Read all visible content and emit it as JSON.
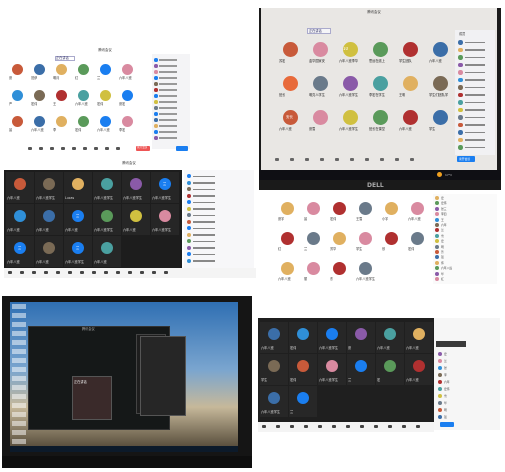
{
  "pane_tl": {
    "title": "腾讯会议",
    "topic": "正在讲话",
    "names": [
      "张",
      "范伊",
      "明月",
      "红",
      "兰",
      "六年八班",
      "严",
      "宏伟",
      "王",
      "六年八班",
      "宏伟",
      "张宏",
      "晨",
      "六年八班",
      "李",
      "宏伟",
      "六年八班",
      "李宏"
    ],
    "leave_button": "离开会议"
  },
  "pane_tr": {
    "title": "腾讯会议",
    "topic": "正在讲话",
    "names": [
      "苏宏",
      "金华国家安",
      "六年八班李华",
      "思远在线上",
      "学生团队",
      "六年八班",
      "班长",
      "明亮人学生",
      "六年八班学生",
      "李宏在学生",
      "王明",
      "学生们团队学",
      "六年八班",
      "张雪",
      "六年八班学生",
      "班长在课堂",
      "六年八班",
      "学生"
    ],
    "sidebar_title": "成员",
    "badge": "10",
    "avatar_badge": "安长",
    "leave_button": "离开会议",
    "weather": "17°C",
    "brand": "DELL"
  },
  "pane_ml": {
    "title": "腾讯会议",
    "names": [
      "六年八班",
      "六年八班学生",
      "Lucas",
      "六年八班学生",
      "六年八班学生",
      "六年八班学生",
      "六年八班",
      "六年八班",
      "六年八班",
      "六年八班学生",
      "六年八班",
      "六年八班学生",
      "六年八班",
      "六年八班",
      "六年八班学生",
      "六年八班"
    ],
    "avatar_badges": [
      "兰",
      "兰",
      "兰",
      "兰",
      "兰"
    ]
  },
  "pane_mr": {
    "names": [
      "张宇",
      "晨",
      "宏伟",
      "王雪",
      "小宇",
      "六年八班",
      "红",
      "兰",
      "芳华",
      "学生",
      "欣",
      "宏伟",
      "六年八班",
      "丽",
      "东",
      "六年八班学生"
    ],
    "side_names": [
      "宏",
      "宏伟",
      "张三",
      "李四",
      "王",
      "六年",
      "兰",
      "雪",
      "宏",
      "明",
      "芳",
      "强",
      "伟",
      "六年八班",
      "华",
      "红"
    ]
  },
  "pane_bl": {
    "window_title": "腾讯会议",
    "card_title": "正在讲话"
  },
  "pane_br": {
    "names": [
      "六年八班",
      "宏伟",
      "六年八班学生",
      "张",
      "六年八班",
      "六年八班",
      "学生",
      "宏伟",
      "六年八班学生",
      "兰",
      "宏",
      "六年八班",
      "六年八班学生",
      "兰"
    ],
    "leave_button": "离开会议",
    "side_names": [
      "宏",
      "兰",
      "张",
      "李",
      "六年",
      "宏伟",
      "雪",
      "华",
      "明",
      "强"
    ]
  }
}
